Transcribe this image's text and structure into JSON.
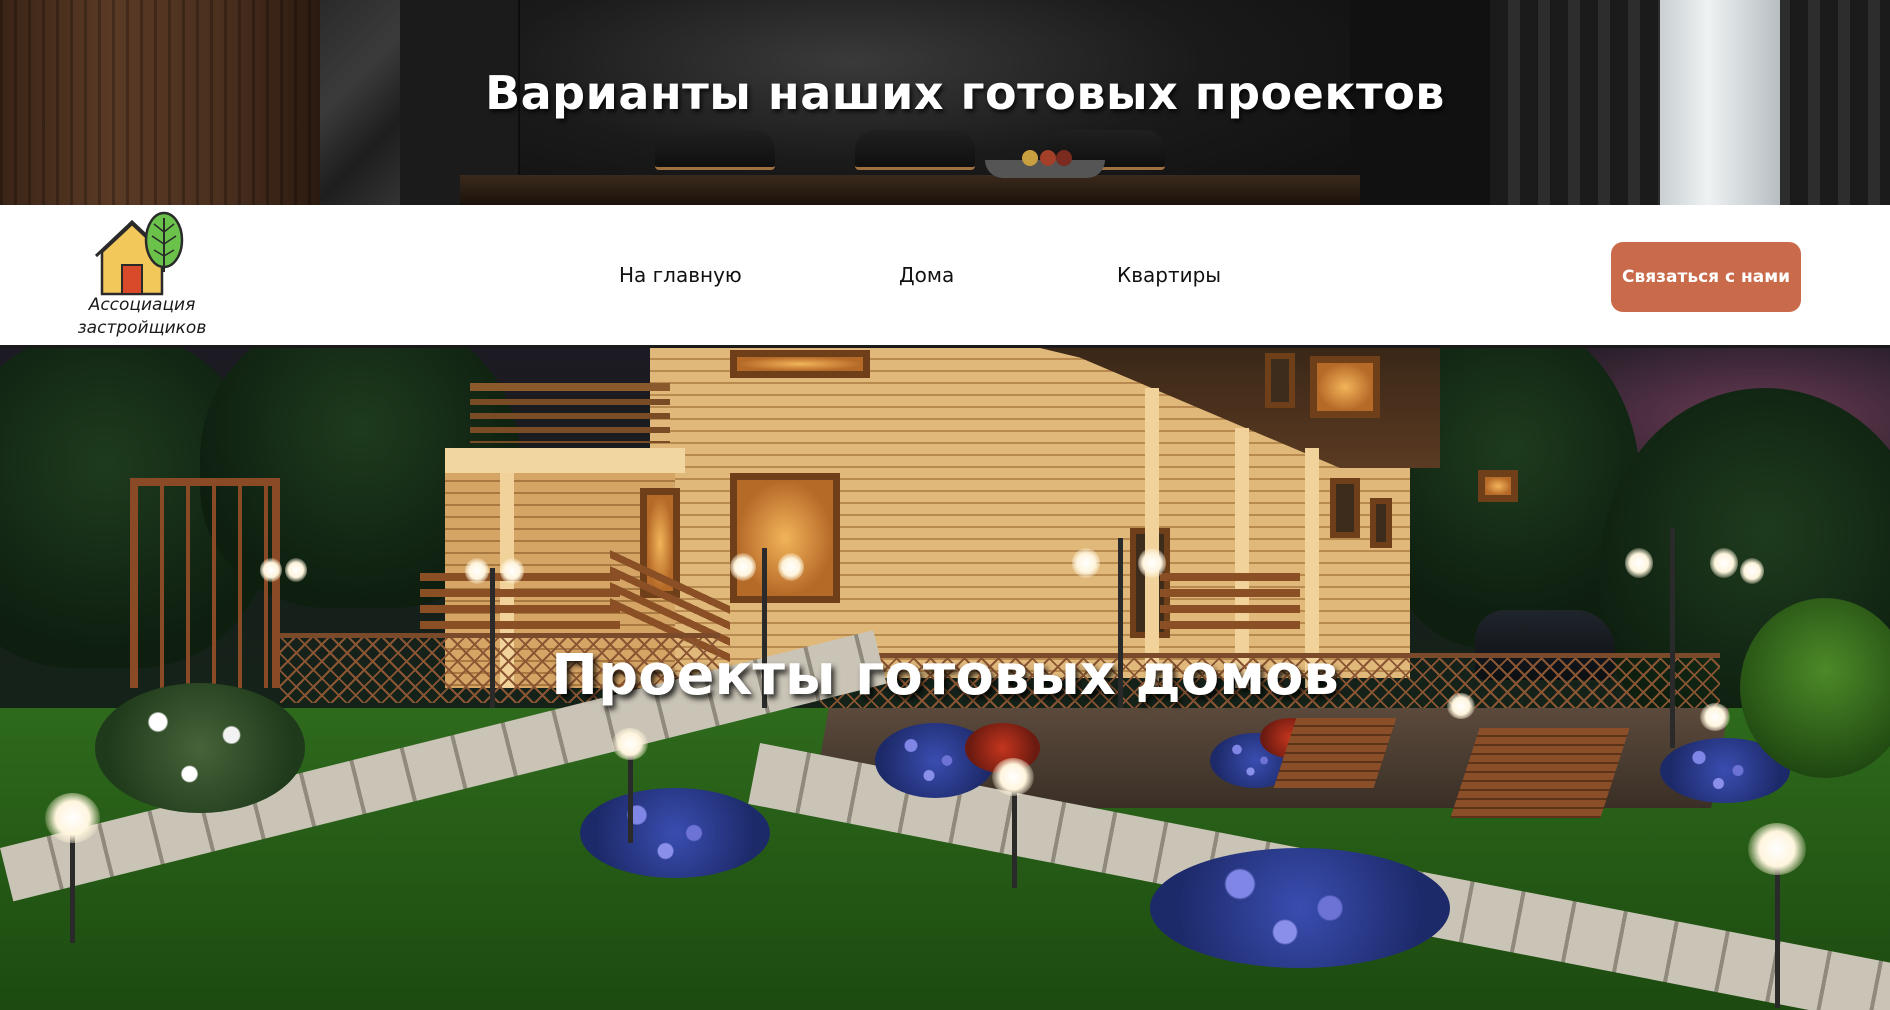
{
  "banner": {
    "title": "Варианты наших готовых проектов"
  },
  "navbar": {
    "logo": {
      "line1": "Ассоциация",
      "line2": "застройщиков",
      "icon": "house-with-tree-icon",
      "colors": {
        "house": "#f3c85a",
        "door": "#d94a2a",
        "leaf": "#6ac24a"
      }
    },
    "links": [
      {
        "label": "На главную"
      },
      {
        "label": "Дома"
      },
      {
        "label": "Квартиры"
      }
    ],
    "contact_button": {
      "label": "Связаться с нами",
      "color": "#c96a4a"
    }
  },
  "hero": {
    "title": "Проекты готовых домов"
  }
}
